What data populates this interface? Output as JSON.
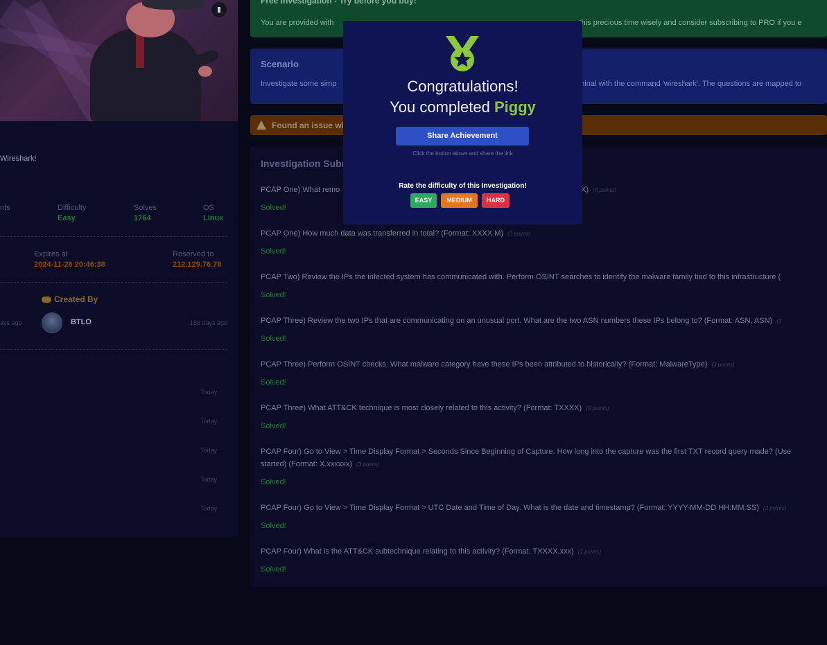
{
  "hero": {
    "bookmark_icon": "bookmark-icon"
  },
  "info": {
    "tagline": "Wireshark!",
    "stats": {
      "points_label_partial": "nts",
      "difficulty_label": "Difficulty",
      "difficulty_value": "Easy",
      "solves_label": "Solves",
      "solves_value": "1764",
      "os_label": "OS",
      "os_value": "Linux"
    },
    "reservation": {
      "expires_label": "Expires at",
      "expires_value": "2024-11-26 20:46:38",
      "reserved_label": "Reserved to",
      "reserved_value": "212.129.76.78"
    },
    "creator": {
      "title": "Created By",
      "left_date": "ays ago",
      "name": "BTLO",
      "right_date": "186 days ago"
    },
    "activity_dates": [
      "Today",
      "Today",
      "Today",
      "Today",
      "Today"
    ]
  },
  "banners": {
    "free_title": "Free Investigation - Try before you buy!",
    "free_text_a": "You are provided with",
    "free_text_b": "e this precious time wisely and consider subscribing to PRO if you e",
    "scenario_title": "Scenario",
    "scenario_text_a": "Investigate some simp",
    "scenario_text_b": "rminal with the command 'wireshark'. The questions are mapped to",
    "issue_text": "Found an issue with"
  },
  "questions": {
    "title": "Investigation Subm",
    "solved_label": "Solved!",
    "items": [
      {
        "text": "PCAP One) What remo",
        "tail": ".X)",
        "points": "(3 points)"
      },
      {
        "text": "PCAP One) How much data was transferred in total? (Format: XXXX M)",
        "points": "(3 points)"
      },
      {
        "text": "PCAP Two) Review the IPs the infected system has communicated with. Perform OSINT searches to identify the malware family tied to this infrastructure (",
        "points": ""
      },
      {
        "text": "PCAP Three) Review the two IPs that are communicating on an unusual port. What are the two ASN numbers these IPs belong to? (Format: ASN, ASN)",
        "points": "(3"
      },
      {
        "text": "PCAP Three) Perform OSINT checks. What malware category have these IPs been attributed to historically? (Format: MalwareType)",
        "points": "(3 points)"
      },
      {
        "text": "PCAP Three) What ATT&CK technique is most closely related to this activity? (Format: TXXXX)",
        "points": "(3 points)"
      },
      {
        "text": "PCAP Four) Go to View > Time Display Format > Seconds Since Beginning of Capture. How long into the capture was the first TXT record query made? (Use",
        "text2": "started) (Format: X.xxxxxx)",
        "points": "(3 points)"
      },
      {
        "text": "PCAP Four) Go to View > Time Display Format > UTC Date and Time of Day. What is the date and timestamp? (Format: YYYY-MM-DD HH:MM:SS)",
        "points": "(3 points)"
      },
      {
        "text": "PCAP Four) What is the ATT&CK subtechnique relating to this activity? (Format: TXXXX.xxx)",
        "points": "(1 points)"
      }
    ]
  },
  "modal": {
    "congrats": "Congratulations!",
    "completed_prefix": "You completed ",
    "investigation_name": "Piggy",
    "share_button": "Share Achievement",
    "share_hint": "Click the button above and share the link",
    "rate_prompt": "Rate the difficulty of this Investigation!",
    "rate_easy": "EASY",
    "rate_medium": "MEDIUM",
    "rate_hard": "HARD"
  },
  "colors": {
    "accent_green": "#8dc63f",
    "share_blue": "#2f4fc7",
    "easy": "#2eaa5e",
    "medium": "#e67520",
    "hard": "#dc3140"
  }
}
